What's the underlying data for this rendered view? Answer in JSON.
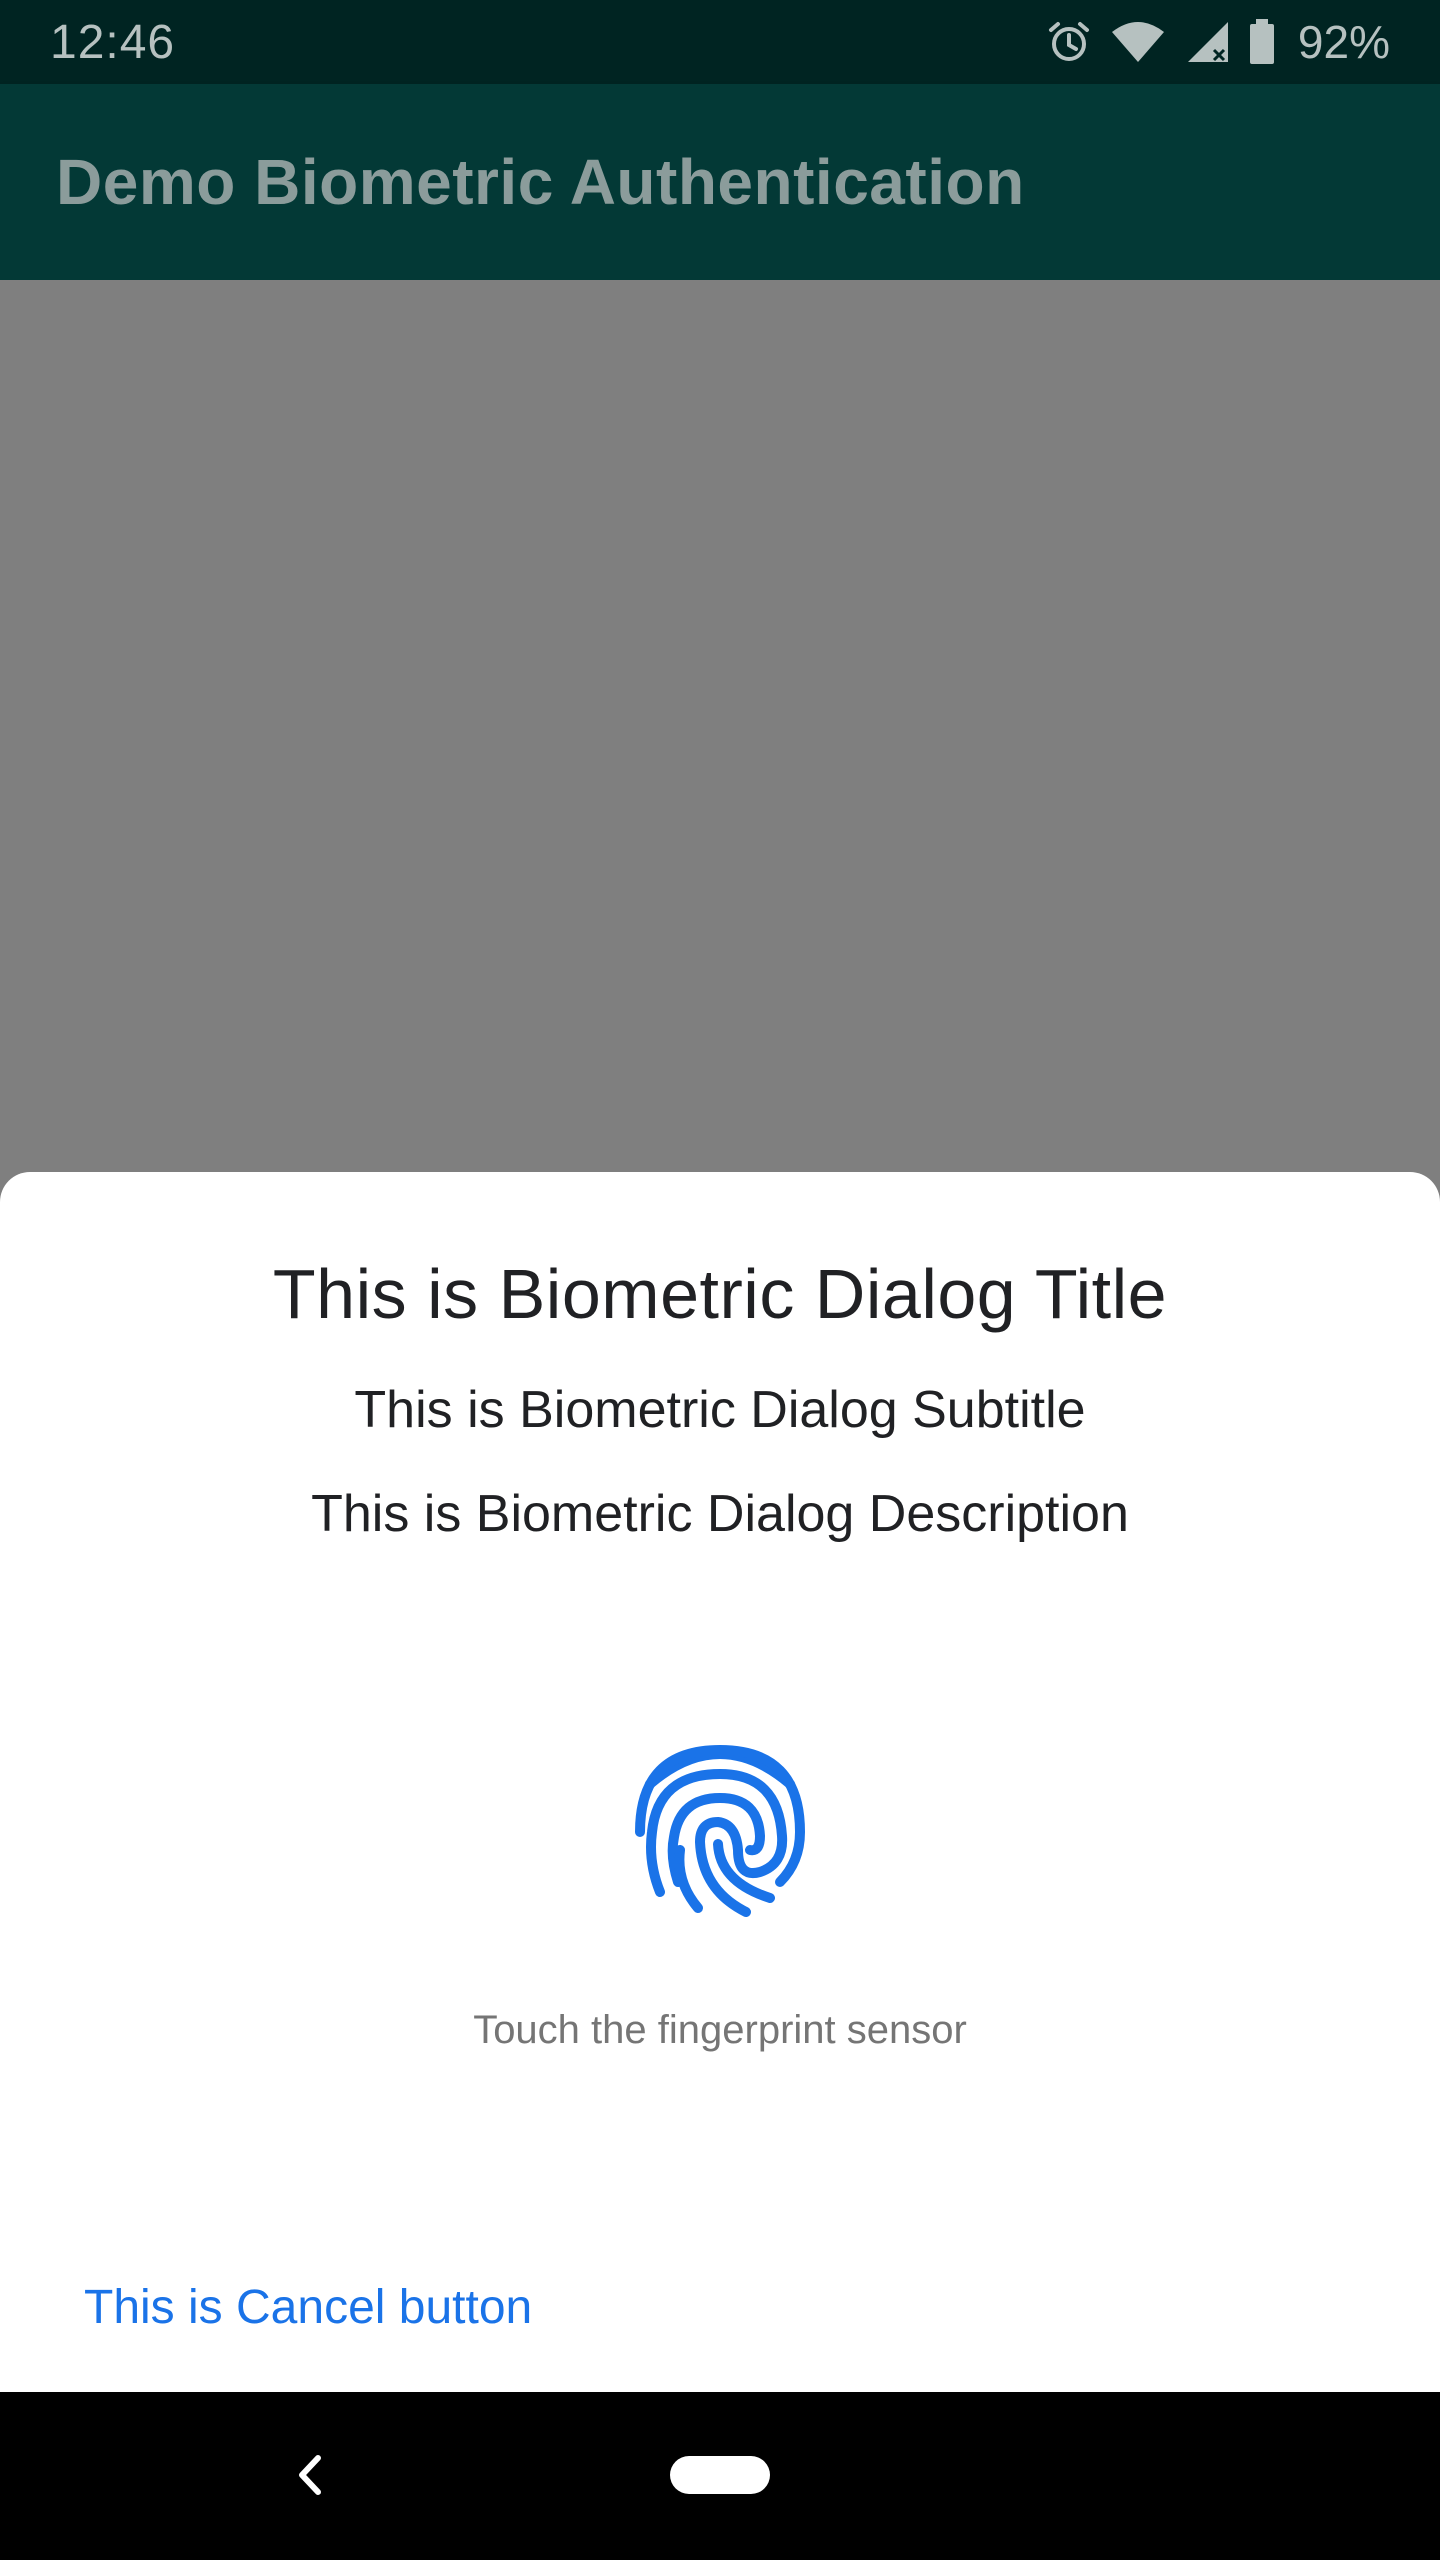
{
  "status_bar": {
    "time": "12:46",
    "battery": "92%",
    "icons": [
      "alarm-icon",
      "wifi-icon",
      "cell-signal-icon",
      "battery-icon"
    ]
  },
  "app_bar": {
    "title": "Demo Biometric Authentication"
  },
  "dialog": {
    "title": "This is Biometric Dialog Title",
    "subtitle": "This is Biometric Dialog Subtitle",
    "description": "This is Biometric Dialog Description",
    "hint": "Touch the fingerprint sensor",
    "cancel_label": "This is Cancel button",
    "icon": "fingerprint-icon"
  },
  "nav_bar": {
    "icons": [
      "back-icon",
      "home-pill"
    ]
  },
  "colors": {
    "status_bar_bg": "#002422",
    "app_bar_bg": "#033936",
    "scrim": "#7f7f7f",
    "accent": "#1a73e8"
  }
}
